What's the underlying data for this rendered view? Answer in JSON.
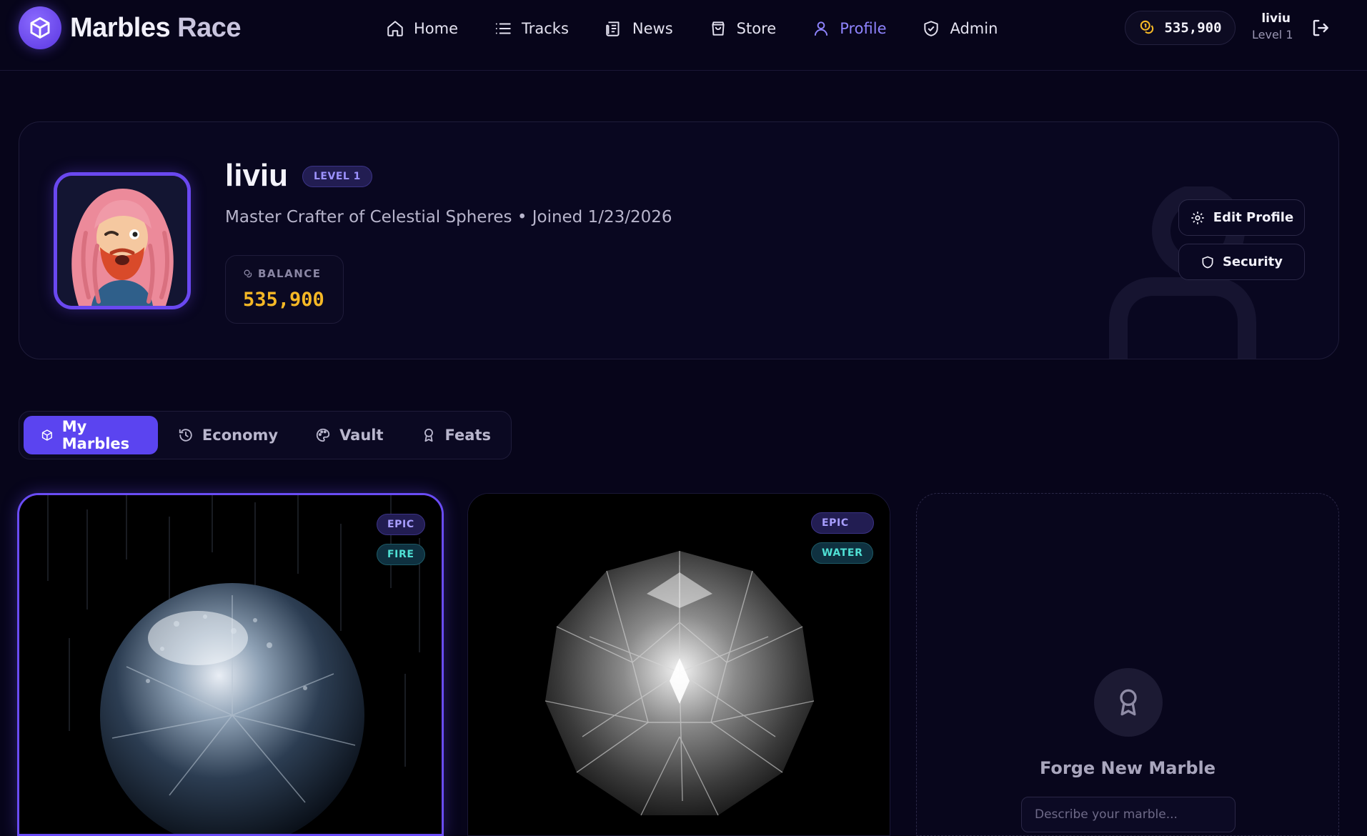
{
  "app": {
    "name_part1": "Marbles",
    "name_part2": " Race"
  },
  "nav": [
    {
      "label": "Home",
      "icon": "home-icon"
    },
    {
      "label": "Tracks",
      "icon": "list-icon"
    },
    {
      "label": "News",
      "icon": "newspaper-icon"
    },
    {
      "label": "Store",
      "icon": "shopping-bag-icon"
    },
    {
      "label": "Profile",
      "icon": "user-icon",
      "active": true
    },
    {
      "label": "Admin",
      "icon": "shield-check-icon"
    }
  ],
  "header": {
    "coins": "535,900",
    "username": "liviu",
    "level": "Level 1"
  },
  "profile": {
    "name": "liviu",
    "level_badge": "LEVEL 1",
    "subtitle": "Master Crafter of Celestial Spheres • Joined 1/23/2026",
    "balance_label": "BALANCE",
    "balance_value": "535,900",
    "edit_button": "Edit Profile",
    "security_button": "Security"
  },
  "tabs": [
    {
      "label": "My Marbles",
      "icon": "cube-icon",
      "active": true
    },
    {
      "label": "Economy",
      "icon": "history-icon"
    },
    {
      "label": "Vault",
      "icon": "palette-icon"
    },
    {
      "label": "Feats",
      "icon": "award-icon"
    }
  ],
  "marbles": [
    {
      "rarity": "EPIC",
      "element": "FIRE",
      "selected": true
    },
    {
      "rarity": "EPIC",
      "element": "WATER",
      "selected": false
    }
  ],
  "forge": {
    "title": "Forge New Marble",
    "placeholder": "Describe your marble..."
  },
  "colors": {
    "accent": "#5b44f0",
    "gold": "#f5b826",
    "teal": "#4fe0d4",
    "background": "#07051a"
  }
}
